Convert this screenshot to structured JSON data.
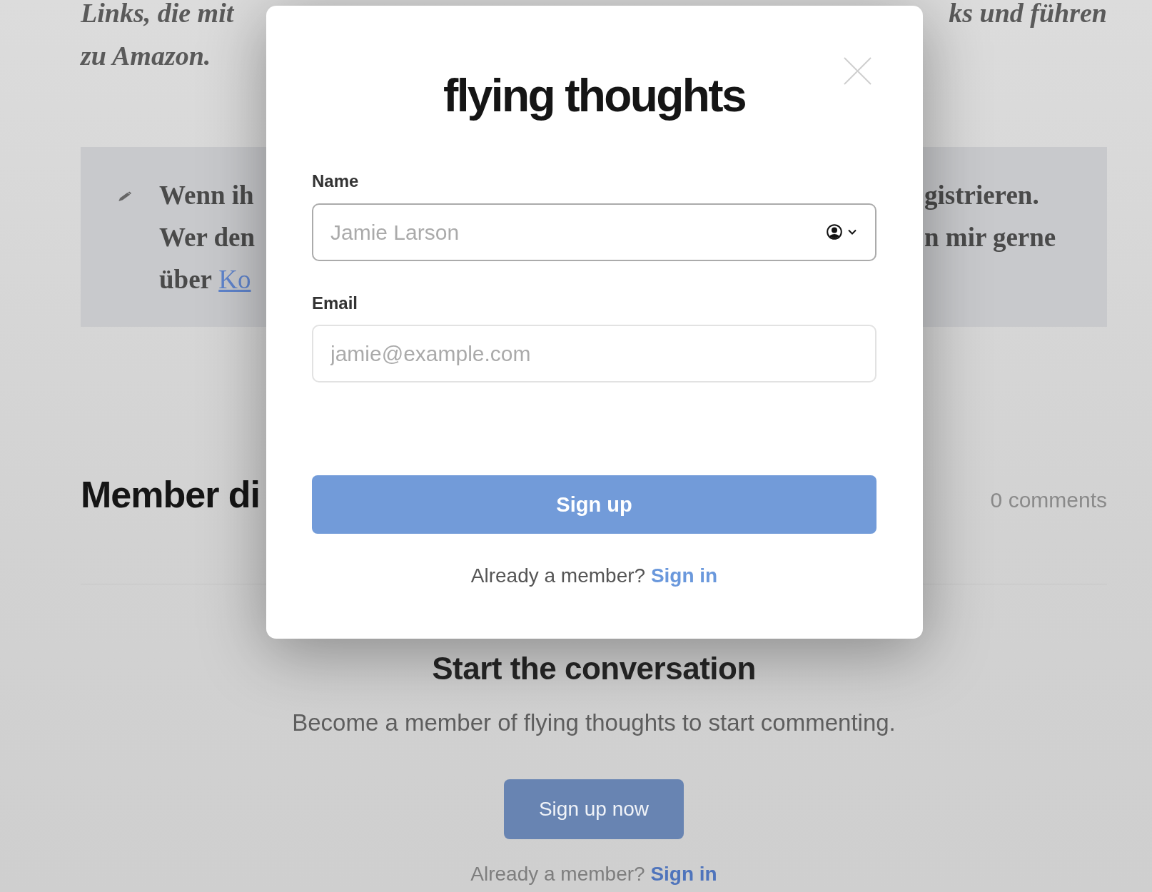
{
  "article": {
    "intro_lines": [
      {
        "left": "Links, die mit",
        "right": "ks und führen"
      },
      {
        "left": "zu Amazon."
      }
    ],
    "callout": {
      "lines": [
        {
          "left": "Wenn ih",
          "right": "gistrieren."
        },
        {
          "left": "Wer den",
          "right": "n mir gerne"
        },
        {
          "left": "über",
          "link": "Ko"
        }
      ]
    },
    "discussion": {
      "heading": "Member di",
      "count": "0 comments",
      "cta_title": "Start the conversation",
      "cta_text": "Become a member of flying thoughts to start commenting.",
      "cta_button": "Sign up now",
      "member_prompt": "Already a member?",
      "sign_in_link": "Sign in"
    }
  },
  "modal": {
    "title": "flying thoughts",
    "fields": [
      {
        "label": "Name",
        "placeholder": "Jamie Larson",
        "focused": true,
        "icon": true
      },
      {
        "label": "Email",
        "placeholder": "jamie@example.com",
        "focused": false,
        "icon": false
      }
    ],
    "submit_button": "Sign up",
    "member_prompt": "Already a member?",
    "sign_in_link": "Sign in"
  }
}
